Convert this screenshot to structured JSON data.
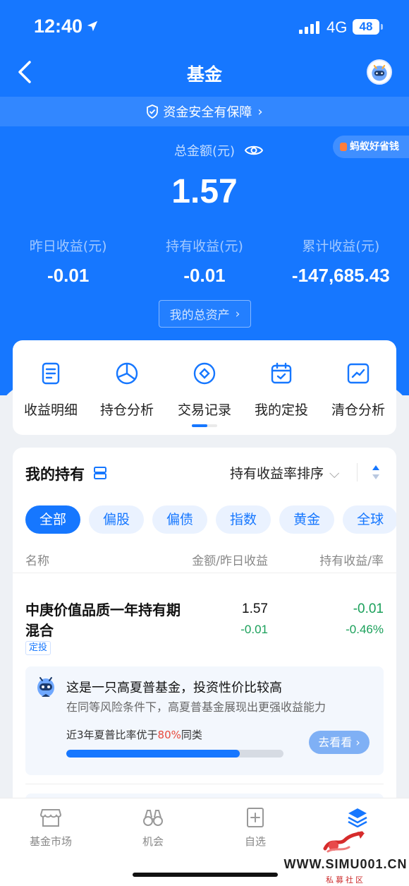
{
  "status_bar": {
    "time": "12:40",
    "network": "4G",
    "battery": "48"
  },
  "nav": {
    "title": "基金"
  },
  "security_banner": {
    "text": "资金安全有保障"
  },
  "summary": {
    "total_label": "总金额(元)",
    "total_value": "1.57",
    "promo_tag": "蚂蚁好省钱",
    "stats": [
      {
        "label": "昨日收益(元)",
        "value": "-0.01"
      },
      {
        "label": "持有收益(元)",
        "value": "-0.01"
      },
      {
        "label": "累计收益(元)",
        "value": "-147,685.43"
      }
    ],
    "total_assets_button": "我的总资产"
  },
  "quick_actions": [
    {
      "label": "收益明细",
      "icon": "document-icon"
    },
    {
      "label": "持仓分析",
      "icon": "pie-chart-icon"
    },
    {
      "label": "交易记录",
      "icon": "diamond-circle-icon"
    },
    {
      "label": "我的定投",
      "icon": "calendar-check-icon"
    },
    {
      "label": "清仓分析",
      "icon": "trend-chart-icon"
    }
  ],
  "holdings": {
    "title": "我的持有",
    "sort_label": "持有收益率排序",
    "filters": [
      "全部",
      "偏股",
      "偏债",
      "指数",
      "黄金",
      "全球"
    ],
    "active_filter": "全部",
    "columns": {
      "name": "名称",
      "amount": "金额/昨日收益",
      "profit": "持有收益/率"
    },
    "funds": [
      {
        "name": "中庚价值品质一年持有期混合",
        "tag": "定投",
        "amount": "1.57",
        "yesterday": "-0.01",
        "hold_profit": "-0.01",
        "hold_rate": "-0.46%"
      }
    ],
    "insight": {
      "title": "这是一只高夏普基金，投资性价比较高",
      "subtitle": "在同等风险条件下，高夏普基金展现出更强收益能力",
      "metric_prefix": "近3年夏普比率优于",
      "metric_pct": "80%",
      "metric_suffix": "同类",
      "progress": 0.8,
      "button": "去看看"
    }
  },
  "tab_bar": [
    {
      "label": "基金市场",
      "icon": "store-icon"
    },
    {
      "label": "机会",
      "icon": "binoculars-icon"
    },
    {
      "label": "自选",
      "icon": "add-bookmark-icon"
    },
    {
      "label": "",
      "icon": "layers-icon"
    }
  ],
  "watermark": {
    "url": "WWW.SIMU001.CN",
    "subtitle": "私募社区"
  },
  "colors": {
    "primary": "#1677ff",
    "loss_green": "#1aa05a",
    "highlight_red": "#e84a3c"
  }
}
